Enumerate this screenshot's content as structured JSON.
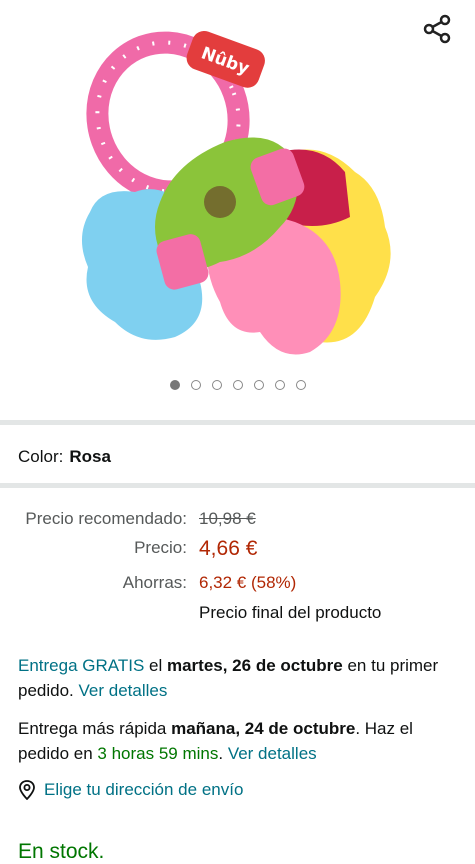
{
  "gallery": {
    "image_alt": "Nûby",
    "brand_logo_text": "Nûby",
    "image_count": 7,
    "active_index": 0
  },
  "color": {
    "label": "Color:",
    "value": "Rosa"
  },
  "pricing": {
    "list_label": "Precio recomendado:",
    "list_value": "10,98 €",
    "price_label": "Precio:",
    "price_value": "4,66 €",
    "savings_label": "Ahorras:",
    "savings_value": "6,32 € (58%)",
    "final_note": "Precio final del producto"
  },
  "delivery": {
    "free_prefix": "Entrega GRATIS",
    "free_mid": " el ",
    "free_date": "martes, 26 de octubre",
    "free_suffix": " en tu primer pedido. ",
    "details_link": "Ver detalles",
    "fast_prefix": "Entrega más rápida ",
    "fast_date": "mañana, 24 de octubre",
    "fast_mid": ". Haz el pedido en ",
    "fast_countdown": "3 horas 59 mins",
    "fast_suffix": ". ",
    "fast_details_link": "Ver detalles"
  },
  "address": {
    "label": "Elige tu dirección de envío",
    "icon": "location-pin-icon"
  },
  "stock": {
    "text": "En stock."
  },
  "colors": {
    "accent": "#007185",
    "price": "#b12704",
    "instock": "#007600"
  }
}
